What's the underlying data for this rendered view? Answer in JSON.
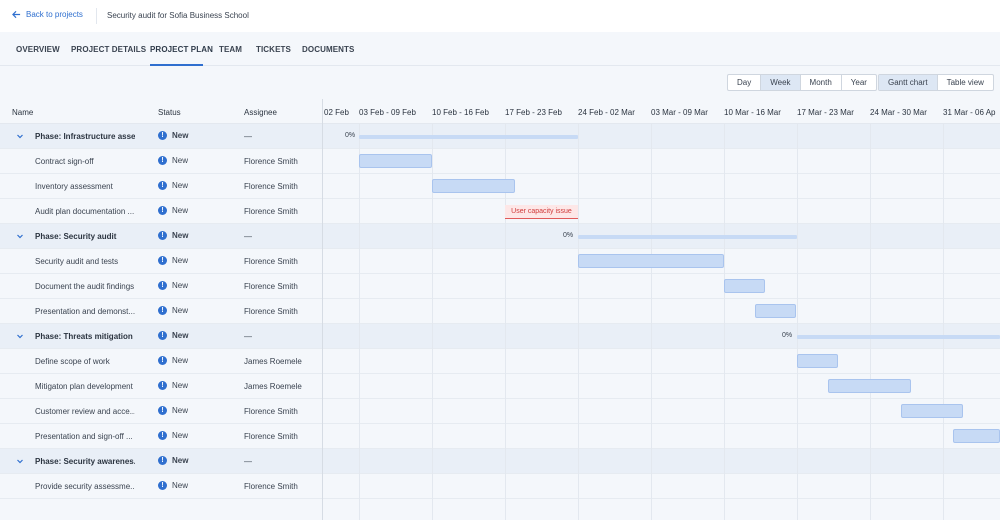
{
  "header": {
    "back_label": "Back to projects",
    "project_title": "Security audit for Sofia Business School"
  },
  "tabs": [
    "OVERVIEW",
    "PROJECT DETAILS",
    "PROJECT PLAN",
    "TEAM",
    "TICKETS",
    "DOCUMENTS"
  ],
  "active_tab": "PROJECT PLAN",
  "scale": {
    "options": [
      "Day",
      "Week",
      "Month",
      "Year"
    ],
    "selected": "Week"
  },
  "view": {
    "options": [
      "Gantt chart",
      "Table view"
    ],
    "selected": "Gantt chart"
  },
  "columns": {
    "name": "Name",
    "status": "Status",
    "assignee": "Assignee"
  },
  "weeks": [
    "02 Feb",
    "03 Feb - 09 Feb",
    "10 Feb - 16 Feb",
    "17 Feb - 23 Feb",
    "24 Feb - 02 Mar",
    "03 Mar - 09 Mar",
    "10 Mar - 16 Mar",
    "17 Mar - 23 Mar",
    "24 Mar - 30 Mar",
    "31 Mar - 06 Ap"
  ],
  "rows": [
    {
      "type": "phase",
      "name": "Phase: Infrastructure asse...",
      "status": "New",
      "assignee": "—",
      "progress": "0%"
    },
    {
      "type": "task",
      "name": "Contract sign-off",
      "status": "New",
      "assignee": "Florence Smith"
    },
    {
      "type": "task",
      "name": "Inventory assessment",
      "status": "New",
      "assignee": "Florence Smith"
    },
    {
      "type": "task",
      "name": "Audit plan documentation ...",
      "status": "New",
      "assignee": "Florence Smith",
      "warning": "User capacity issue"
    },
    {
      "type": "phase",
      "name": "Phase: Security audit",
      "status": "New",
      "assignee": "—",
      "progress": "0%"
    },
    {
      "type": "task",
      "name": "Security audit and tests",
      "status": "New",
      "assignee": "Florence Smith"
    },
    {
      "type": "task",
      "name": "Document the audit findings",
      "status": "New",
      "assignee": "Florence Smith"
    },
    {
      "type": "task",
      "name": "Presentation and demonst...",
      "status": "New",
      "assignee": "Florence Smith"
    },
    {
      "type": "phase",
      "name": "Phase: Threats mitigation",
      "status": "New",
      "assignee": "—",
      "progress": "0%"
    },
    {
      "type": "task",
      "name": "Define scope of work",
      "status": "New",
      "assignee": "James Roemele"
    },
    {
      "type": "task",
      "name": "Mitigaton plan development",
      "status": "New",
      "assignee": "James Roemele"
    },
    {
      "type": "task",
      "name": "Customer review and acce...",
      "status": "New",
      "assignee": "Florence Smith"
    },
    {
      "type": "task",
      "name": "Presentation and sign-off ...",
      "status": "New",
      "assignee": "Florence Smith"
    },
    {
      "type": "phase",
      "name": "Phase: Security awarenes...",
      "status": "New",
      "assignee": "—"
    },
    {
      "type": "task",
      "name": "Provide security assessme...",
      "status": "New",
      "assignee": "Florence Smith"
    }
  ],
  "colors": {
    "accent": "#2f6fcf",
    "bar": "#c7daf5",
    "warning": "#d03a3a"
  }
}
